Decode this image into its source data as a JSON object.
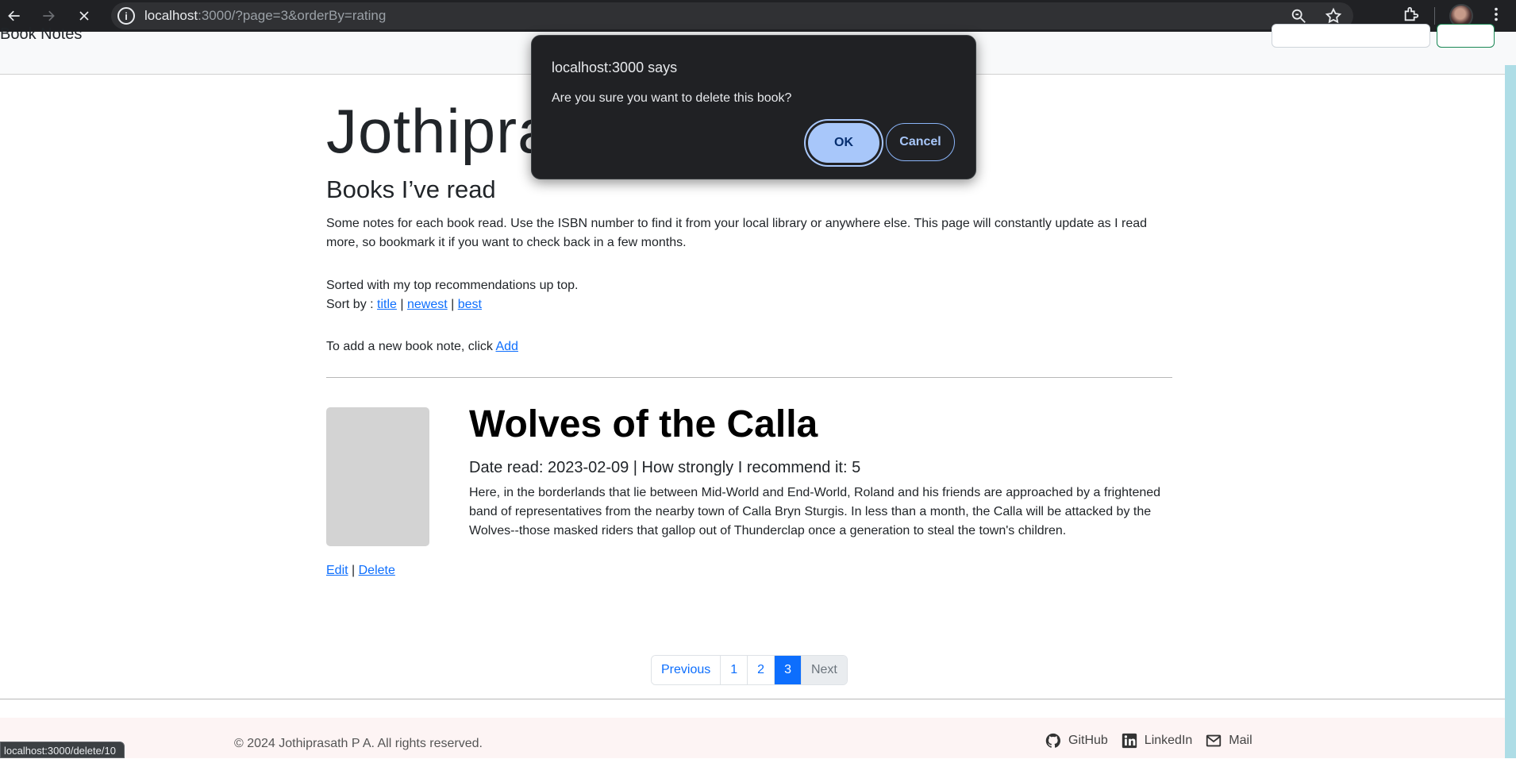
{
  "browser": {
    "url_host": "localhost",
    "url_rest": ":3000/?page=3&orderBy=rating",
    "status_url": "localhost:3000/delete/10"
  },
  "navbar": {
    "brand": "Book Notes"
  },
  "page": {
    "big_title": "Jothiprasath",
    "subtitle": "Books I’ve read",
    "intro": "Some notes for each book read. Use the ISBN number to find it from your local library or anywhere else. This page will constantly update as I read more, so bookmark it if you want to check back in a few months.",
    "sorted_text": "Sorted with my top recommendations up top.",
    "sort_by_label": "Sort by : ",
    "sort_title": "title",
    "sort_newest": "newest",
    "sort_best": "best",
    "sort_sep": " | ",
    "add_text": "To add a new book note, click ",
    "add_link": "Add"
  },
  "book": {
    "title": "Wolves of the Calla",
    "meta": "Date read: 2023-02-09 | How strongly I recommend it: 5",
    "description": "Here, in the borderlands that lie between Mid-World and End-World, Roland and his friends are approached by a frightened band of representatives from the nearby town of Calla Bryn Sturgis. In less than a month, the Calla will be attacked by the Wolves--those masked riders that gallop out of Thunderclap once a generation to steal the town's children.",
    "edit_label": "Edit",
    "delete_label": "Delete",
    "action_sep": " | "
  },
  "pagination": {
    "previous": "Previous",
    "pages": [
      "1",
      "2",
      "3"
    ],
    "active_page": "3",
    "next": "Next"
  },
  "footer": {
    "copyright": "© 2024 Jothiprasath P A. All rights reserved.",
    "github": "GitHub",
    "linkedin": "LinkedIn",
    "mail": "Mail"
  },
  "dialog": {
    "title": "localhost:3000 says",
    "message": "Are you sure you want to delete this book?",
    "ok_label": "OK",
    "cancel_label": "Cancel"
  },
  "colors": {
    "link": "#0d6efd",
    "dialog_bg": "#202124",
    "ok_bg": "#a8c7fa",
    "scrollbar": "#aedde6"
  }
}
